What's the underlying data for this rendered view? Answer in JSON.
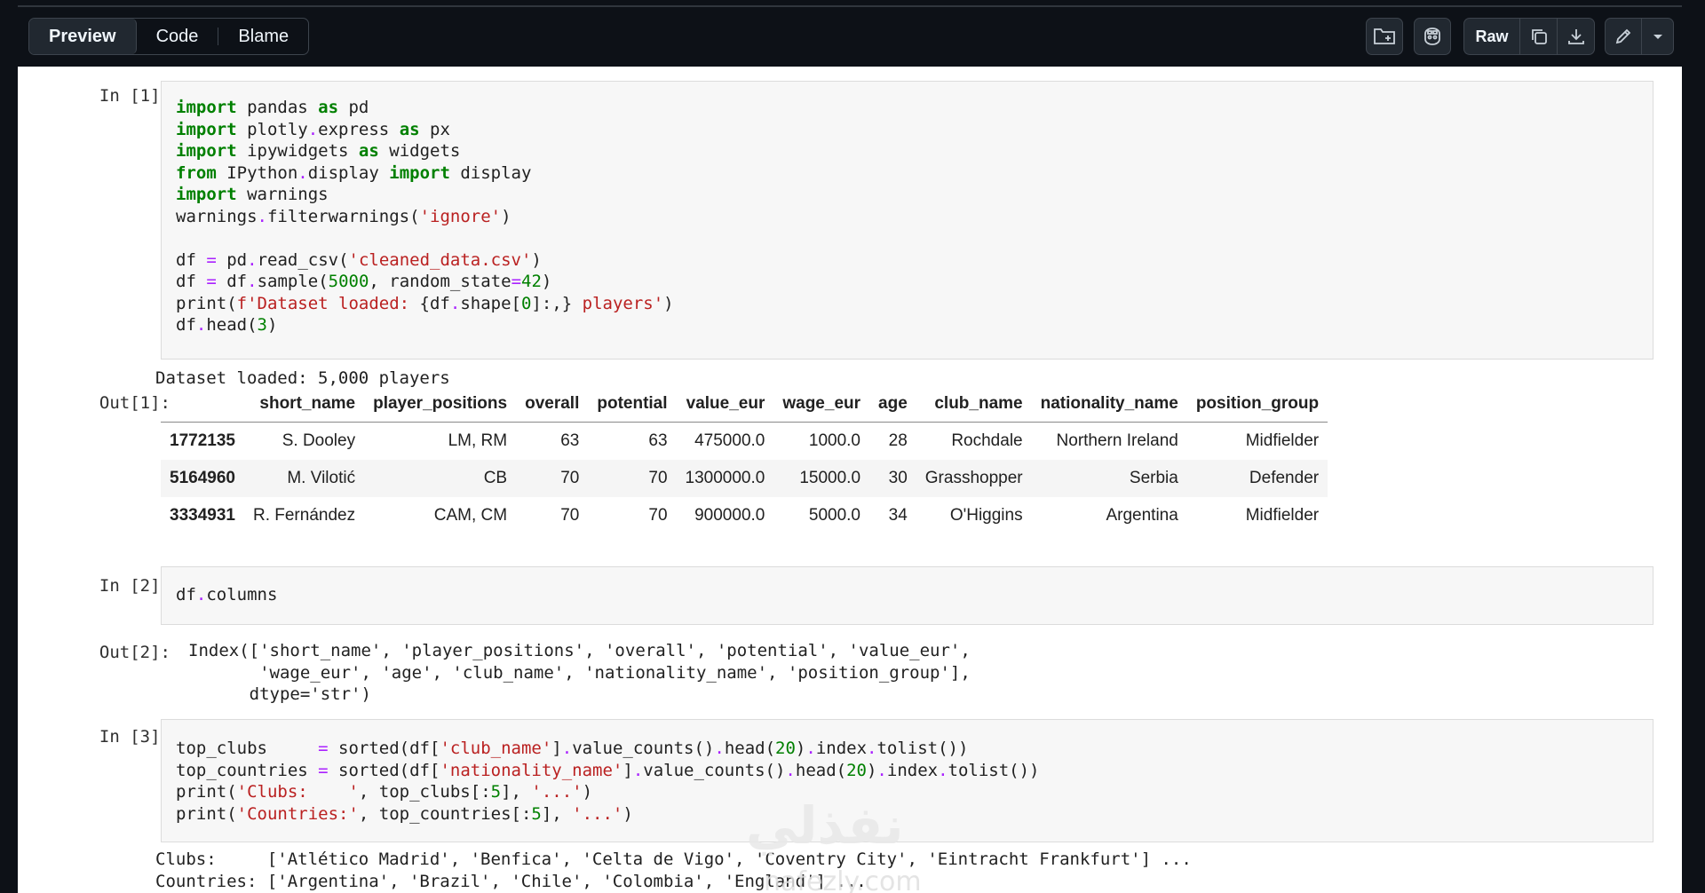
{
  "toolbar": {
    "tabs": [
      "Preview",
      "Code",
      "Blame"
    ],
    "raw_label": "Raw"
  },
  "cells": [
    {
      "in_prompt": "In [1]:",
      "code": [
        [
          [
            "k",
            "import"
          ],
          [
            "p",
            " pandas "
          ],
          [
            "k",
            "as"
          ],
          [
            "p",
            " pd"
          ]
        ],
        [
          [
            "k",
            "import"
          ],
          [
            "p",
            " plotly"
          ],
          [
            "o",
            "."
          ],
          [
            "p",
            "express "
          ],
          [
            "k",
            "as"
          ],
          [
            "p",
            " px"
          ]
        ],
        [
          [
            "k",
            "import"
          ],
          [
            "p",
            " ipywidgets "
          ],
          [
            "k",
            "as"
          ],
          [
            "p",
            " widgets"
          ]
        ],
        [
          [
            "k",
            "from"
          ],
          [
            "p",
            " IPython"
          ],
          [
            "o",
            "."
          ],
          [
            "p",
            "display "
          ],
          [
            "k",
            "import"
          ],
          [
            "p",
            " display"
          ]
        ],
        [
          [
            "k",
            "import"
          ],
          [
            "p",
            " warnings"
          ]
        ],
        [
          [
            "p",
            "warnings"
          ],
          [
            "o",
            "."
          ],
          [
            "p",
            "filterwarnings("
          ],
          [
            "s",
            "'ignore'"
          ],
          [
            "p",
            ")"
          ]
        ],
        [
          [
            "p",
            ""
          ]
        ],
        [
          [
            "p",
            "df "
          ],
          [
            "o",
            "="
          ],
          [
            "p",
            " pd"
          ],
          [
            "o",
            "."
          ],
          [
            "p",
            "read_csv("
          ],
          [
            "s",
            "'cleaned_data.csv'"
          ],
          [
            "p",
            ")"
          ]
        ],
        [
          [
            "p",
            "df "
          ],
          [
            "o",
            "="
          ],
          [
            "p",
            " df"
          ],
          [
            "o",
            "."
          ],
          [
            "p",
            "sample("
          ],
          [
            "n",
            "5000"
          ],
          [
            "p",
            ", random_state"
          ],
          [
            "o",
            "="
          ],
          [
            "n",
            "42"
          ],
          [
            "p",
            ")"
          ]
        ],
        [
          [
            "p",
            "print("
          ],
          [
            "s",
            "f'Dataset loaded: "
          ],
          [
            "p",
            "{df"
          ],
          [
            "o",
            "."
          ],
          [
            "p",
            "shape["
          ],
          [
            "n",
            "0"
          ],
          [
            "p",
            "]:,}"
          ],
          [
            "s",
            " players'"
          ],
          [
            "p",
            ")"
          ]
        ],
        [
          [
            "p",
            "df"
          ],
          [
            "o",
            "."
          ],
          [
            "p",
            "head("
          ],
          [
            "n",
            "3"
          ],
          [
            "p",
            ")"
          ]
        ]
      ],
      "stdout": "Dataset loaded: 5,000 players",
      "out_prompt": "Out[1]:",
      "table": {
        "columns": [
          "",
          "short_name",
          "player_positions",
          "overall",
          "potential",
          "value_eur",
          "wage_eur",
          "age",
          "club_name",
          "nationality_name",
          "position_group"
        ],
        "rows": [
          [
            "1772135",
            "S. Dooley",
            "LM, RM",
            "63",
            "63",
            "475000.0",
            "1000.0",
            "28",
            "Rochdale",
            "Northern Ireland",
            "Midfielder"
          ],
          [
            "5164960",
            "M. Vilotić",
            "CB",
            "70",
            "70",
            "1300000.0",
            "15000.0",
            "30",
            "Grasshopper",
            "Serbia",
            "Defender"
          ],
          [
            "3334931",
            "R. Fernández",
            "CAM, CM",
            "70",
            "70",
            "900000.0",
            "5000.0",
            "34",
            "O'Higgins",
            "Argentina",
            "Midfielder"
          ]
        ]
      }
    },
    {
      "in_prompt": "In [2]:",
      "code": [
        [
          [
            "p",
            "df"
          ],
          [
            "o",
            "."
          ],
          [
            "p",
            "columns"
          ]
        ]
      ],
      "out_prompt": "Out[2]:",
      "output": "Index(['short_name', 'player_positions', 'overall', 'potential', 'value_eur',\n       'wage_eur', 'age', 'club_name', 'nationality_name', 'position_group'],\n      dtype='str')"
    },
    {
      "in_prompt": "In [3]:",
      "code": [
        [
          [
            "p",
            "top_clubs     "
          ],
          [
            "o",
            "="
          ],
          [
            "p",
            " sorted(df["
          ],
          [
            "s",
            "'club_name'"
          ],
          [
            "p",
            "]"
          ],
          [
            "o",
            "."
          ],
          [
            "p",
            "value_counts()"
          ],
          [
            "o",
            "."
          ],
          [
            "p",
            "head("
          ],
          [
            "n",
            "20"
          ],
          [
            "p",
            ")"
          ],
          [
            "o",
            "."
          ],
          [
            "p",
            "index"
          ],
          [
            "o",
            "."
          ],
          [
            "p",
            "tolist())"
          ]
        ],
        [
          [
            "p",
            "top_countries "
          ],
          [
            "o",
            "="
          ],
          [
            "p",
            " sorted(df["
          ],
          [
            "s",
            "'nationality_name'"
          ],
          [
            "p",
            "]"
          ],
          [
            "o",
            "."
          ],
          [
            "p",
            "value_counts()"
          ],
          [
            "o",
            "."
          ],
          [
            "p",
            "head("
          ],
          [
            "n",
            "20"
          ],
          [
            "p",
            ")"
          ],
          [
            "o",
            "."
          ],
          [
            "p",
            "index"
          ],
          [
            "o",
            "."
          ],
          [
            "p",
            "tolist())"
          ]
        ],
        [
          [
            "p",
            "print("
          ],
          [
            "s",
            "'Clubs:    '"
          ],
          [
            "p",
            ", top_clubs[:"
          ],
          [
            "n",
            "5"
          ],
          [
            "p",
            "], "
          ],
          [
            "s",
            "'...'"
          ],
          [
            "p",
            ")"
          ]
        ],
        [
          [
            "p",
            "print("
          ],
          [
            "s",
            "'Countries:'"
          ],
          [
            "p",
            ", top_countries[:"
          ],
          [
            "n",
            "5"
          ],
          [
            "p",
            "], "
          ],
          [
            "s",
            "'...'"
          ],
          [
            "p",
            ")"
          ]
        ]
      ],
      "stdout": "Clubs:     ['Atlético Madrid', 'Benfica', 'Celta de Vigo', 'Coventry City', 'Eintracht Frankfurt'] ...\nCountries: ['Argentina', 'Brazil', 'Chile', 'Colombia', 'England'] ..."
    }
  ],
  "watermark": {
    "main": "نفذلي",
    "sub": "nafezly.com"
  }
}
